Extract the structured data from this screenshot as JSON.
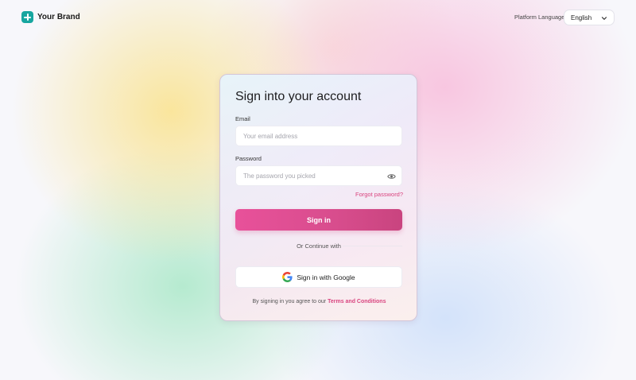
{
  "brand": {
    "name": "Your Brand",
    "icon": "plus-icon",
    "color": "#17a6a0"
  },
  "language": {
    "label": "Platform Language:",
    "selected": "English"
  },
  "login": {
    "title": "Sign into your account",
    "email_label": "Email",
    "email_placeholder": "Your email address",
    "email_value": "",
    "password_label": "Password",
    "password_placeholder": "The password you picked",
    "password_value": "",
    "forgot_label": "Forgot password?",
    "signin_label": "Sign in",
    "divider_label": "Or Continue with",
    "google_label": "Sign in with Google",
    "terms_prefix": "By signing in you agree to our",
    "terms_link": "Terms and Conditions"
  },
  "colors": {
    "accent": "#e8519a",
    "link": "#d9457f"
  }
}
